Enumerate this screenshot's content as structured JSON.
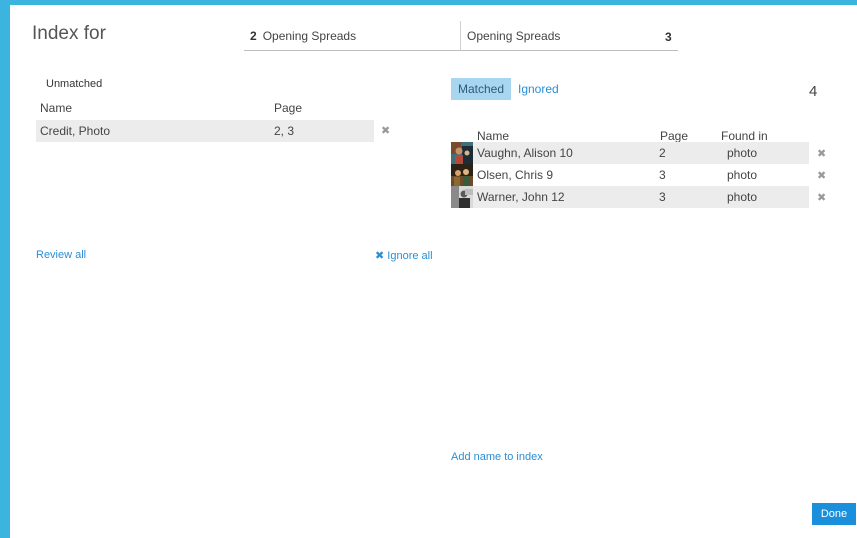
{
  "header": {
    "title": "Index for",
    "left_tab": {
      "number": "2",
      "label": "Opening Spreads"
    },
    "right_tab": {
      "label": "Opening Spreads",
      "number": "3"
    }
  },
  "unmatched": {
    "title": "Unmatched",
    "columns": {
      "name": "Name",
      "page": "Page"
    },
    "rows": [
      {
        "name": "Credit, Photo",
        "page": "2, 3"
      }
    ],
    "review_all": "Review all",
    "ignore_all": "Ignore all"
  },
  "matched": {
    "tabs": {
      "matched": "Matched",
      "ignored": "Ignored"
    },
    "count": "4",
    "columns": {
      "name": "Name",
      "page": "Page",
      "found_in": "Found in"
    },
    "rows": [
      {
        "name": "Vaughn, Alison 10",
        "page": "2",
        "found_in": "photo"
      },
      {
        "name": "Olsen, Chris 9",
        "page": "3",
        "found_in": "photo"
      },
      {
        "name": "Warner, John 12",
        "page": "3",
        "found_in": "photo"
      }
    ],
    "add_name": "Add name to index"
  },
  "footer": {
    "done": "Done"
  },
  "colors": {
    "accent": "#3cb4e0",
    "link": "#2a8fd6",
    "button": "#1a8fdc",
    "active_tab": "#a8d6f0"
  }
}
